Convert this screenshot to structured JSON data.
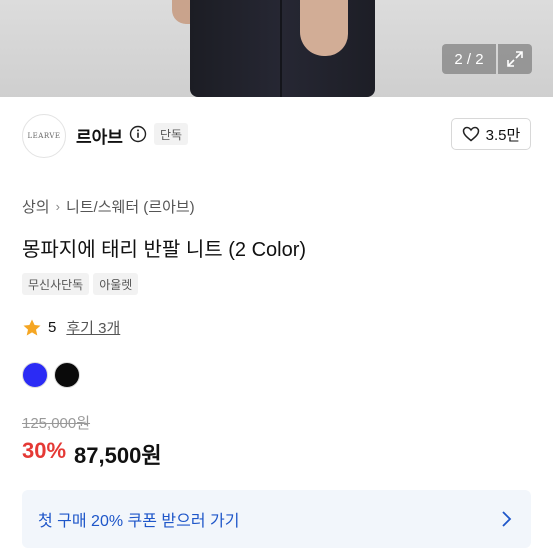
{
  "gallery": {
    "counter": "2 / 2",
    "expand_icon": "expand-icon"
  },
  "brand": {
    "logo_text": "LEARVE",
    "name": "르아브",
    "exclusive_tag": "단독",
    "like_count": "3.5만"
  },
  "breadcrumb": {
    "category": "상의",
    "subcategory": "니트/스웨터 (르아브)"
  },
  "product": {
    "title": "몽파지에 태리 반팔 니트 (2 Color)",
    "badges": [
      "무신사단독",
      "아울렛"
    ],
    "rating": "5",
    "review_label": "후기 3개",
    "colors": [
      "#2b2bf5",
      "#0a0a0a"
    ]
  },
  "price": {
    "original": "125,000원",
    "discount": "30%",
    "final": "87,500원"
  },
  "coupon": {
    "label": "첫 구매 20% 쿠폰 받으러 가기"
  },
  "theme": {
    "accent_blue": "#1e56c9",
    "discount_red": "#e53935",
    "star_color": "#f5a623"
  }
}
